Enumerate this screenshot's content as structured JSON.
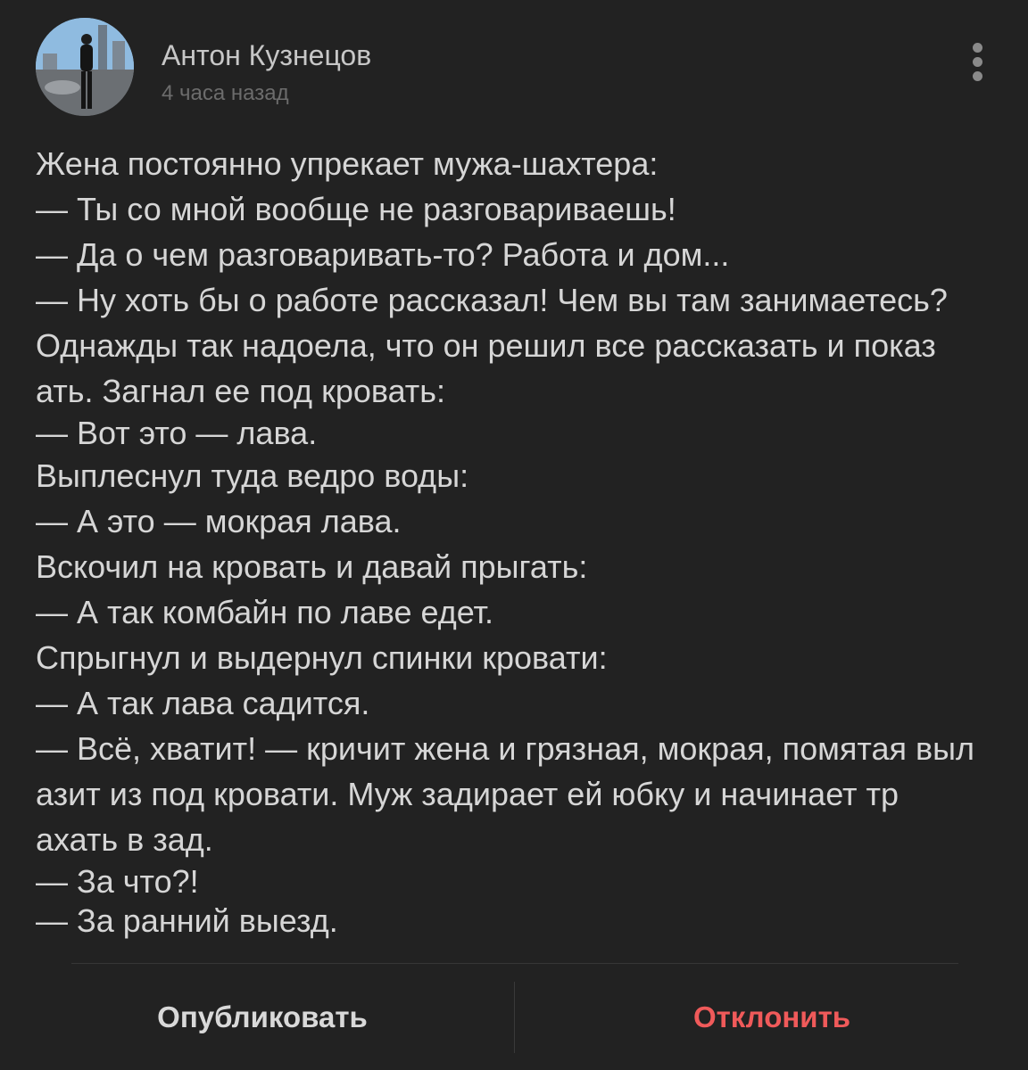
{
  "post": {
    "author_name": "Антон Кузнецов",
    "time_ago": "4 часа назад",
    "more_icon": "vertical-ellipsis-icon",
    "lines": [
      "Жена постоянно упрекает мужа-шахтера:",
      "— Ты со мной вообще не разговариваешь!",
      "— Да о чем разговаривать-то? Работа и дом...",
      "— Ну хоть бы о работе рассказал! Чем вы там занимаетесь?",
      "Однажды так надоела, что он решил все рассказать и показ",
      "ать. Загнал ее под кровать:",
      "— Вот это — лава.",
      "Выплеснул туда ведро воды:",
      "— А это — мокрая лава.",
      "Вскочил на кровать и давай прыгать:",
      "— А так комбайн по лаве едет.",
      "Спрыгнул и выдернул спинки кровати:",
      "— А так лава садится.",
      "— Всё, хватит! — кричит жена и грязная, мокрая, помятая выл",
      "азит из под кровати. Муж задирает ей юбку и начинает тр",
      "ахать в зад.",
      "— За что?!",
      "— За ранний выезд."
    ]
  },
  "actions": {
    "publish_label": "Опубликовать",
    "reject_label": "Отклонить"
  },
  "colors": {
    "background": "#222222",
    "text": "#d6d6d6",
    "muted": "#6c6c6c",
    "reject": "#f05a5a"
  }
}
